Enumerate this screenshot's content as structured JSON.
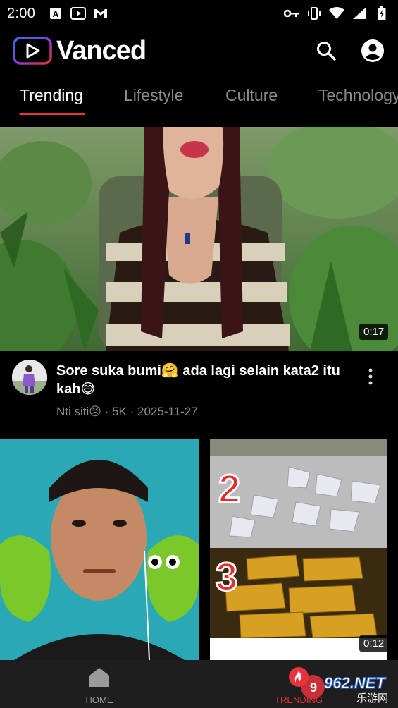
{
  "status_bar": {
    "time": "2:00",
    "left_icons": [
      "a-notification-icon",
      "youtube-notification-icon",
      "gmail-notification-icon"
    ],
    "right_icons": [
      "vpn-key-icon",
      "vibrate-icon",
      "wifi-icon",
      "signal-icon",
      "battery-charging-icon"
    ]
  },
  "app_bar": {
    "title": "Vanced",
    "actions": [
      "search-icon",
      "account-icon"
    ]
  },
  "tabs": [
    {
      "label": "Trending",
      "active": true
    },
    {
      "label": "Lifestyle",
      "active": false
    },
    {
      "label": "Culture",
      "active": false
    },
    {
      "label": "Technology",
      "active": false
    }
  ],
  "videos": [
    {
      "duration": "0:17",
      "title": "Sore suka bumi🤗 ada lagi selain kata2 itu kah😅",
      "channel": "Nti siti😣",
      "views": "5K",
      "date": "2025-11-27",
      "subtitle": "Nti siti😣 · 5K · 2025-11-27"
    },
    {
      "duration": "0:12",
      "thumb_text_2": "2",
      "thumb_text_3": "3"
    }
  ],
  "bottom_nav": [
    {
      "label": "HOME",
      "icon": "home-icon",
      "active": false
    },
    {
      "label": "TRENDING",
      "icon": "trending-icon",
      "active": true
    }
  ],
  "watermark": {
    "text": "962.NET",
    "sub": "乐游网"
  },
  "colors": {
    "accent": "#e8323c",
    "background": "#000000",
    "nav_background": "#1e1e1e",
    "secondary_text": "#8d8d8d"
  }
}
